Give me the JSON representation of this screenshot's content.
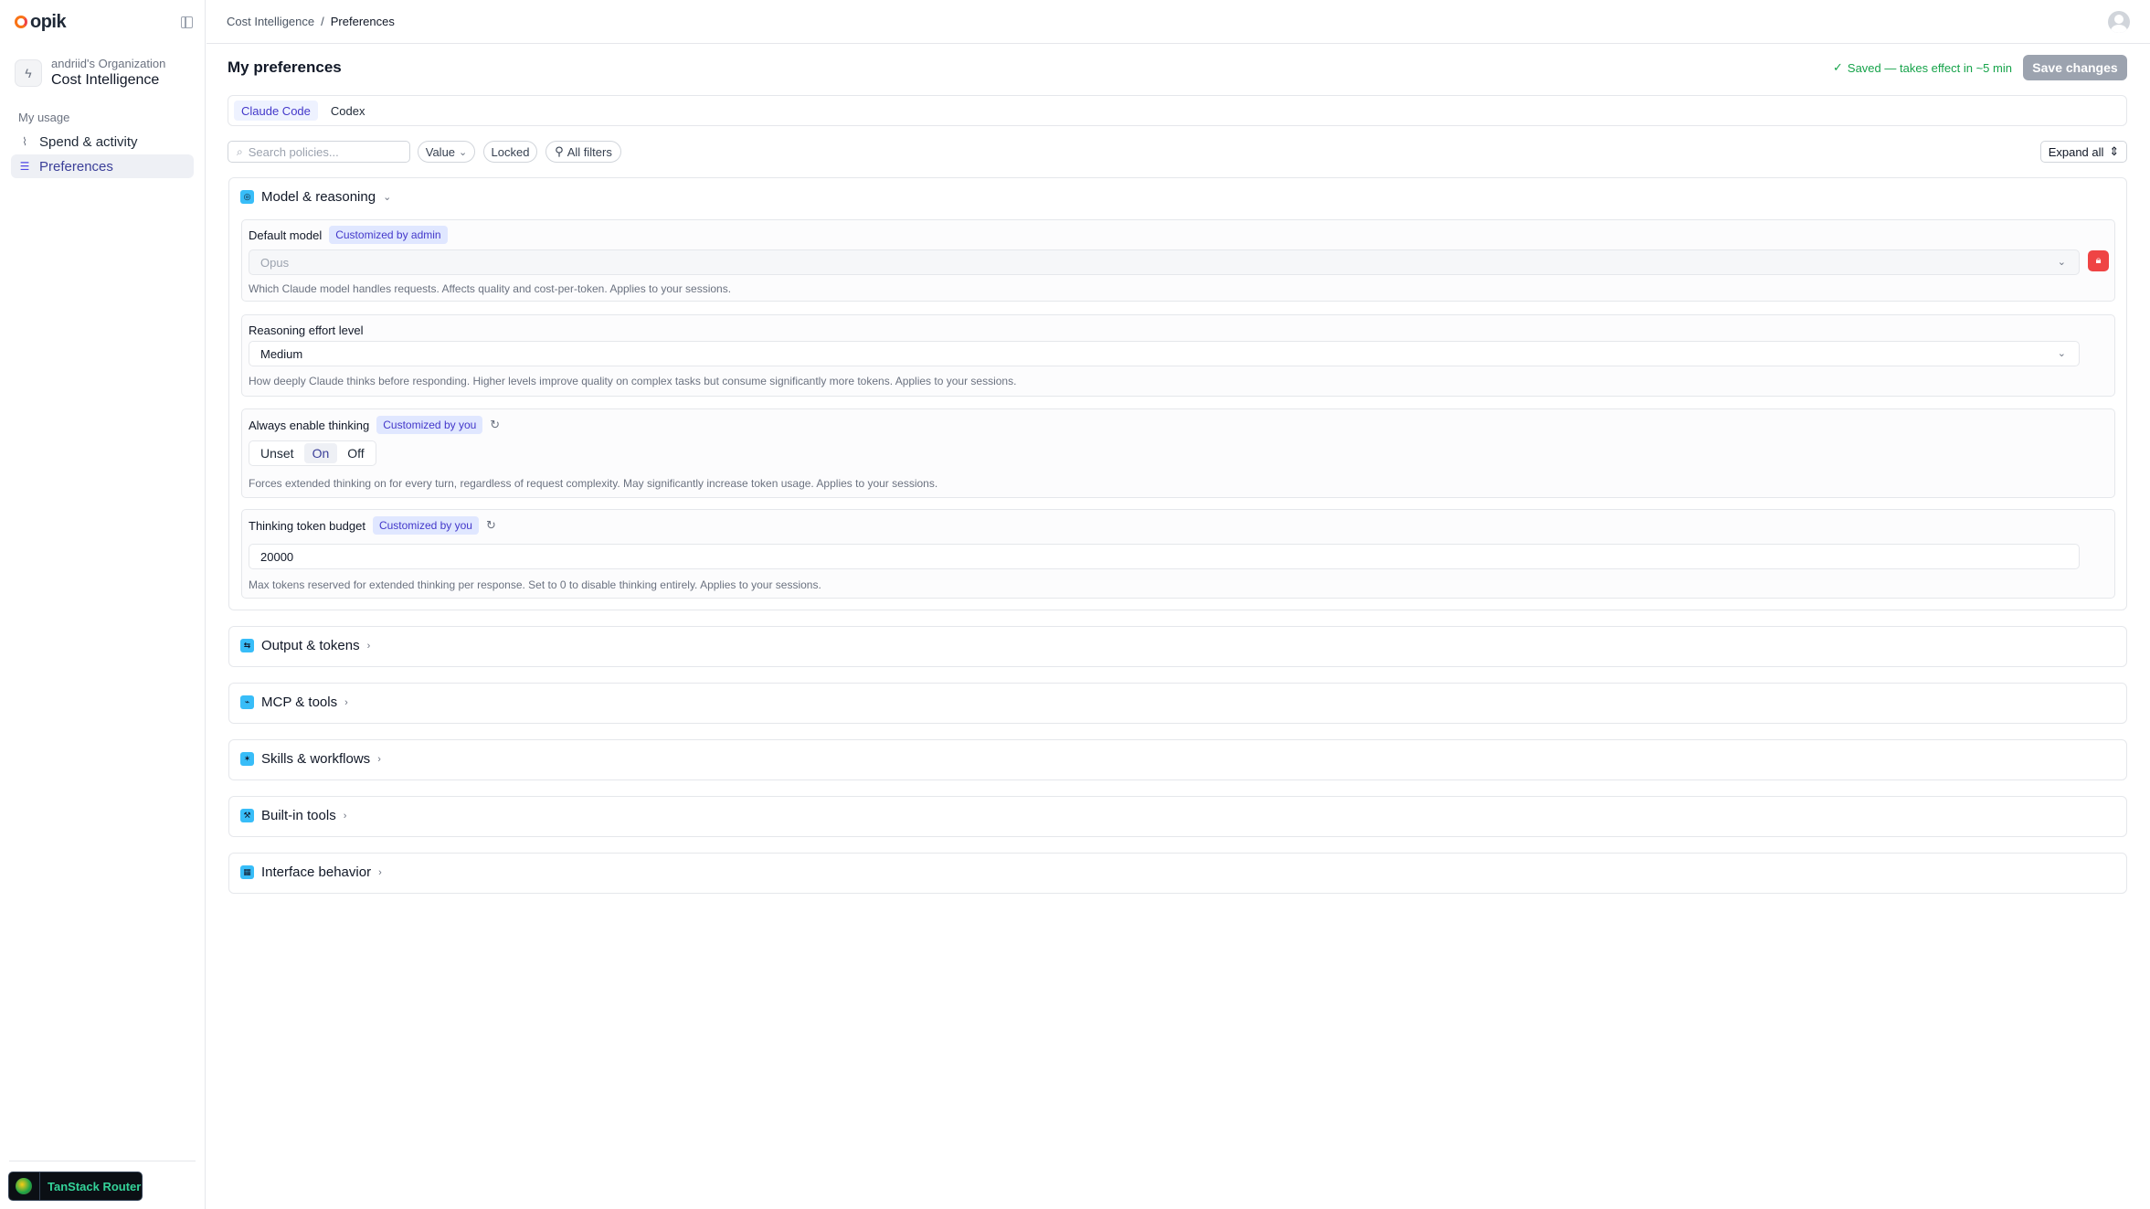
{
  "app": {
    "logo_text": "opik"
  },
  "sidebar": {
    "org_name": "andriid's Organization",
    "project_name": "Cost Intelligence",
    "section_label": "My usage",
    "items": [
      {
        "label": "Spend & activity",
        "icon": "activity-icon",
        "active": false
      },
      {
        "label": "Preferences",
        "icon": "sliders-icon",
        "active": true
      }
    ],
    "devtools_label": "TanStack Router"
  },
  "breadcrumb": {
    "parent": "Cost Intelligence",
    "separator": "/",
    "current": "Preferences"
  },
  "page": {
    "title": "My preferences",
    "save_status": "Saved — takes effect in ~5 min",
    "save_button": "Save changes"
  },
  "agent_tabs": [
    {
      "label": "Claude Code",
      "active": true
    },
    {
      "label": "Codex",
      "active": false
    }
  ],
  "toolbar": {
    "search_placeholder": "Search policies...",
    "filter_value": "Value",
    "filter_locked": "Locked",
    "filter_all": "All filters",
    "expand_all": "Expand all"
  },
  "sections": [
    {
      "title": "Model & reasoning",
      "expanded": true
    },
    {
      "title": "Output & tokens",
      "expanded": false
    },
    {
      "title": "MCP & tools",
      "expanded": false
    },
    {
      "title": "Skills & workflows",
      "expanded": false
    },
    {
      "title": "Built-in tools",
      "expanded": false
    },
    {
      "title": "Interface behavior",
      "expanded": false
    }
  ],
  "policies": {
    "default_model": {
      "label": "Default model",
      "badge": "Customized by admin",
      "value": "Opus",
      "locked": true,
      "description": "Which Claude model handles requests. Affects quality and cost-per-token. Applies to your sessions."
    },
    "reasoning_effort": {
      "label": "Reasoning effort level",
      "value": "Medium",
      "description": "How deeply Claude thinks before responding. Higher levels improve quality on complex tasks but consume significantly more tokens. Applies to your sessions."
    },
    "always_thinking": {
      "label": "Always enable thinking",
      "badge": "Customized by you",
      "options": [
        "Unset",
        "On",
        "Off"
      ],
      "selected": "On",
      "description": "Forces extended thinking on for every turn, regardless of request complexity. May significantly increase token usage. Applies to your sessions."
    },
    "thinking_budget": {
      "label": "Thinking token budget",
      "badge": "Customized by you",
      "value": "20000",
      "description": "Max tokens reserved for extended thinking per response. Set to 0 to disable thinking entirely. Applies to your sessions."
    }
  },
  "colors": {
    "accent": "#4338ca",
    "success": "#16a34a",
    "danger": "#ef4444",
    "brand": "#f97316"
  }
}
